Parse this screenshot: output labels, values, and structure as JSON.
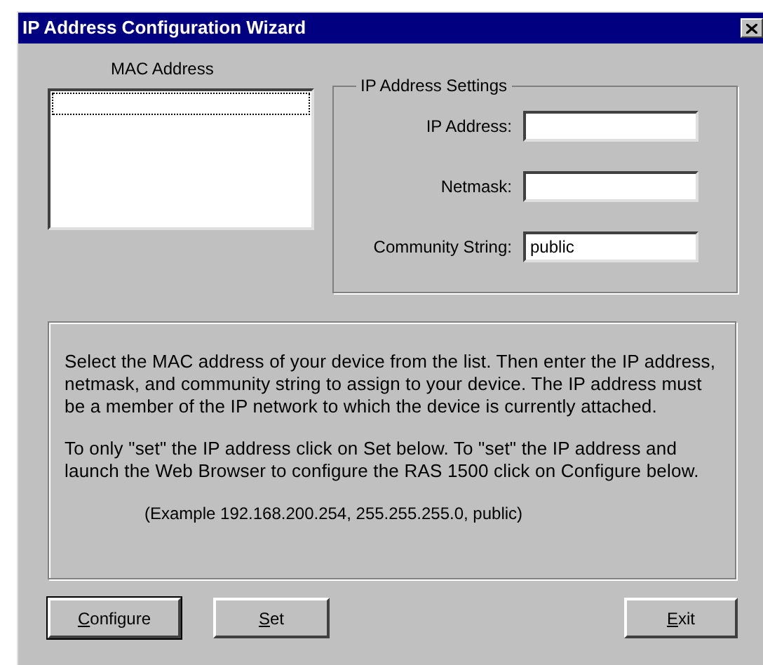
{
  "window": {
    "title": "IP Address Configuration Wizard"
  },
  "mac_list": {
    "label": "MAC Address",
    "focused": true
  },
  "settings": {
    "title": "IP Address Settings",
    "fields": [
      {
        "label": "IP Address:"
      },
      {
        "label": "Netmask:"
      },
      {
        "label": "Community String:",
        "value": "public"
      }
    ]
  },
  "info": {
    "paragraphs": [
      "Select the MAC address of your device from the list. Then enter the IP address, netmask, and community string to assign to your device. The IP address must be a member of the IP network to which the device is currently attached.",
      "To only \"set\" the IP address click on Set below. To \"set\" the IP address and launch the Web Browser to configure the RAS 1500 click on Configure below."
    ],
    "example": "(Example 192.168.200.254, 255.255.255.0, public)"
  },
  "buttons": [
    {
      "label": "Configure",
      "default": true,
      "mnemonic_underlined": true
    },
    {
      "label": "Set",
      "default": false,
      "mnemonic_underlined": true
    },
    {
      "label": "Exit",
      "default": false,
      "mnemonic_underlined": true
    }
  ]
}
